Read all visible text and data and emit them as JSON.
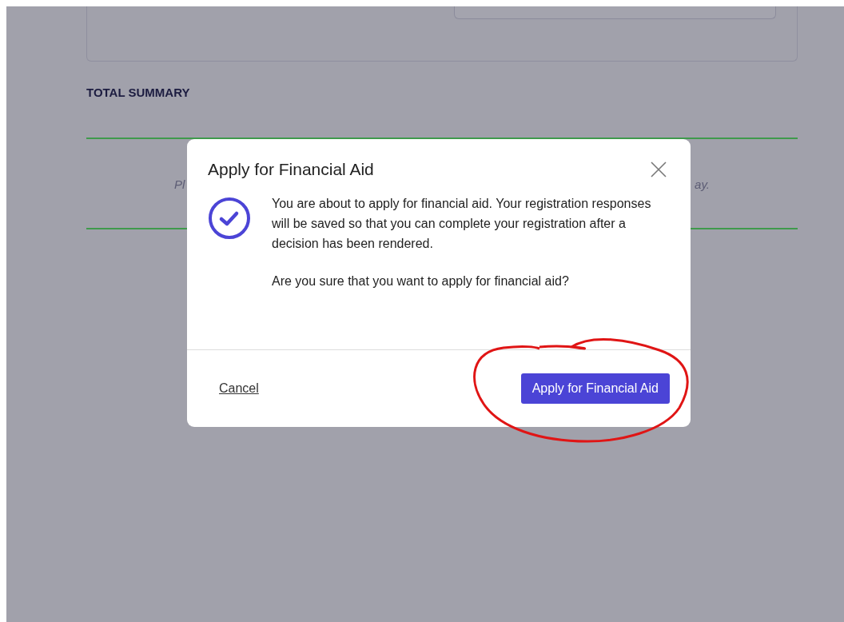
{
  "summary": {
    "heading": "TOTAL SUMMARY",
    "note_left": "Pl",
    "note_right": "ay."
  },
  "dialog": {
    "title": "Apply for Financial Aid",
    "message": "You are about to apply for financial aid. Your registration responses will be saved so that you can complete your registration after a decision has been rendered.",
    "question": "Are you sure that you want to apply for financial aid?",
    "cancel": "Cancel",
    "confirm": "Apply for Financial Aid"
  }
}
